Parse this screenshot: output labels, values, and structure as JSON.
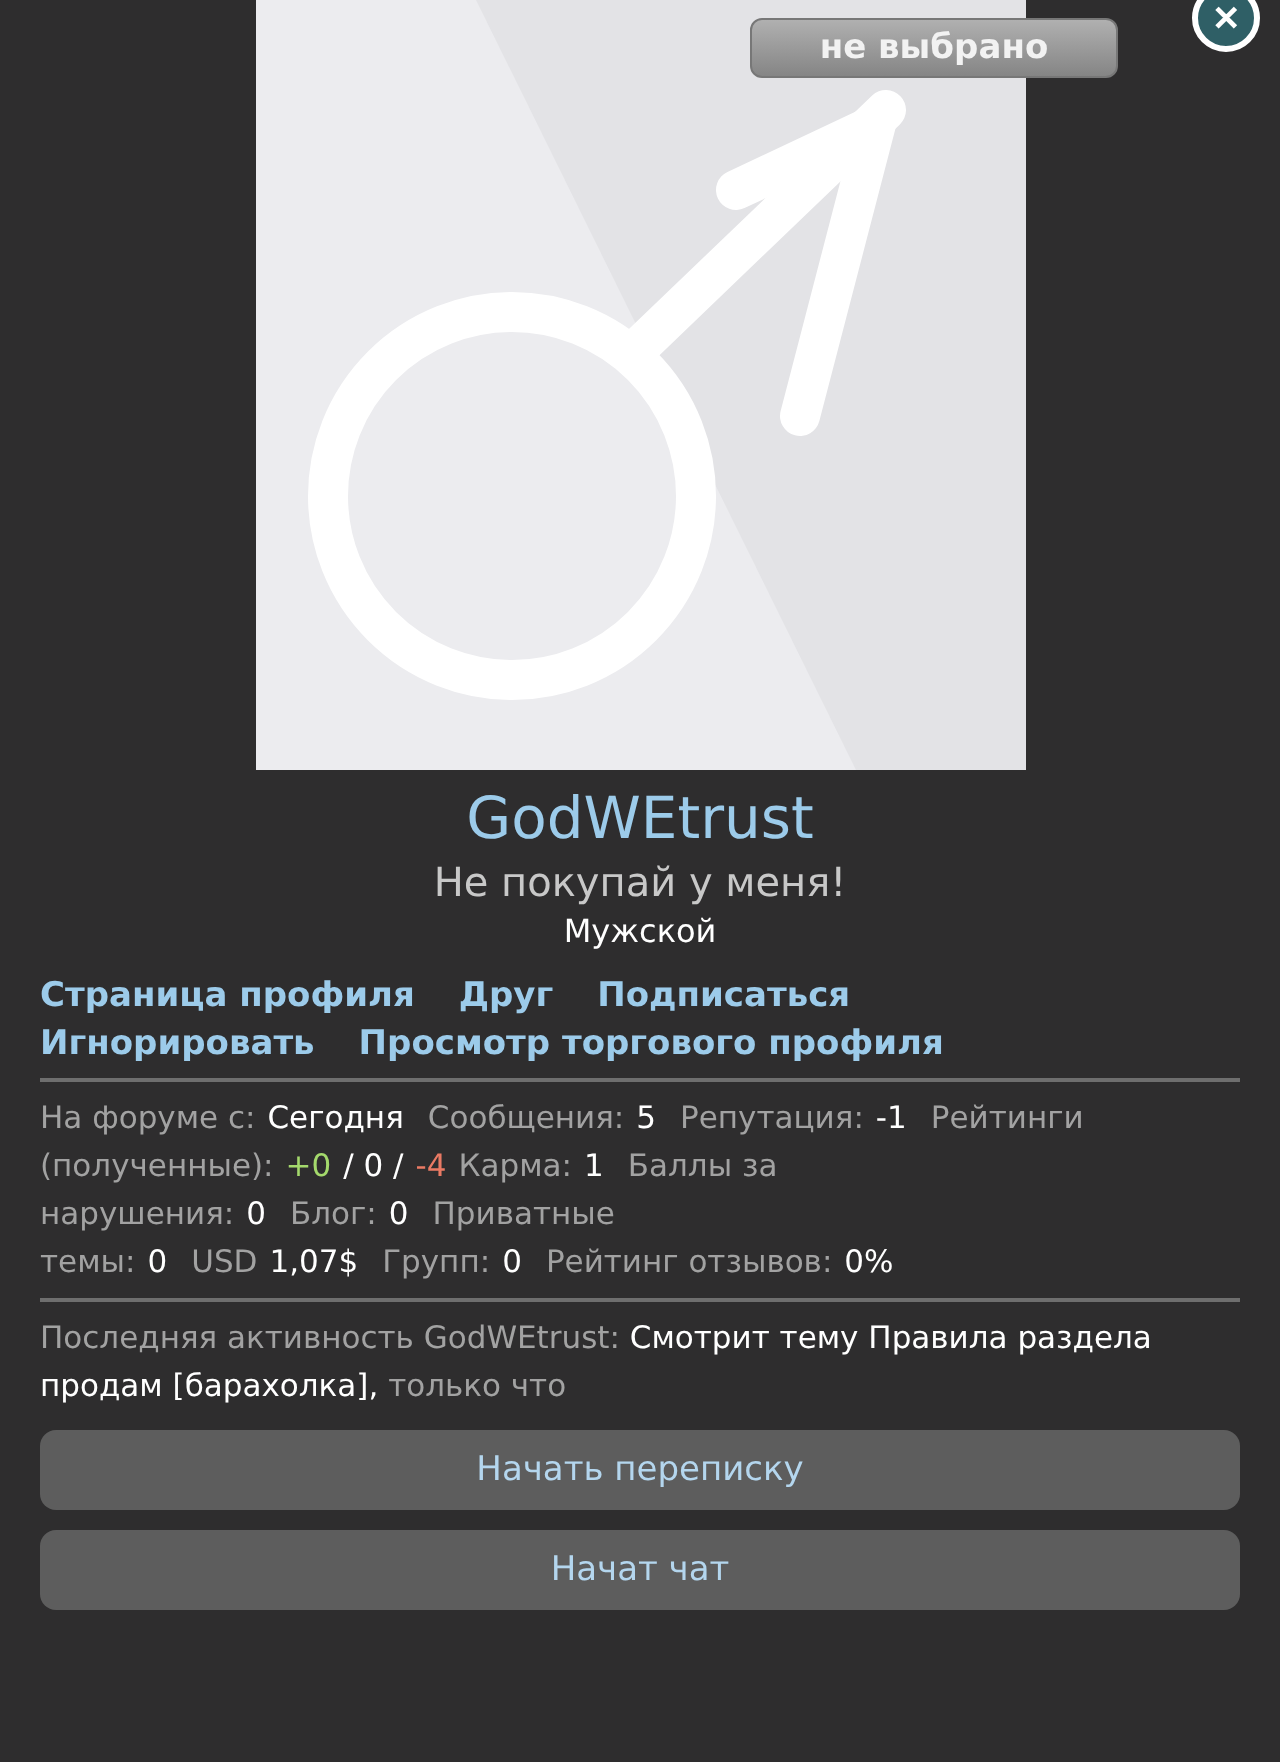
{
  "profile": {
    "status_badge": "не выбрано",
    "close": "✕",
    "username": "GodWEtrust",
    "title": "Не покупай у меня!",
    "gender": "Мужской"
  },
  "links": [
    {
      "label": "Страница профиля"
    },
    {
      "label": "Друг"
    },
    {
      "label": "Подписаться"
    },
    {
      "label": "Игнорировать"
    },
    {
      "label": "Просмотр торгового профиля"
    }
  ],
  "stats": [
    {
      "label": "На форуме с:",
      "value": "Сегодня"
    },
    {
      "label": "Сообщения:",
      "value": "5"
    },
    {
      "label": "Репутация:",
      "value": "-1"
    },
    {
      "label": "Рейтинги (полученные):",
      "parts": [
        {
          "text": "+0",
          "color": "#a4d96c"
        },
        {
          "text": "/ 0 /",
          "color": "#ffffff"
        },
        {
          "text": "-4",
          "color": "#ea7a64"
        }
      ]
    },
    {
      "label": "Карма:",
      "value": "1"
    },
    {
      "label": "Баллы за нарушения:",
      "value": "0"
    },
    {
      "label": "Блог:",
      "value": "0"
    },
    {
      "label": "Приватные темы:",
      "value": "0"
    },
    {
      "label": "USD",
      "value": "1,07$"
    },
    {
      "label": "Групп:",
      "value": "0"
    },
    {
      "label": "Рейтинг отзывов:",
      "value": "0%"
    }
  ],
  "last_activity": {
    "label": "Последняя активность GodWEtrust:",
    "value": "Смотрит тему Правила раздела продам [барахолка],",
    "time": "только что"
  },
  "buttons": [
    "Начать переписку",
    "Начат чат"
  ]
}
